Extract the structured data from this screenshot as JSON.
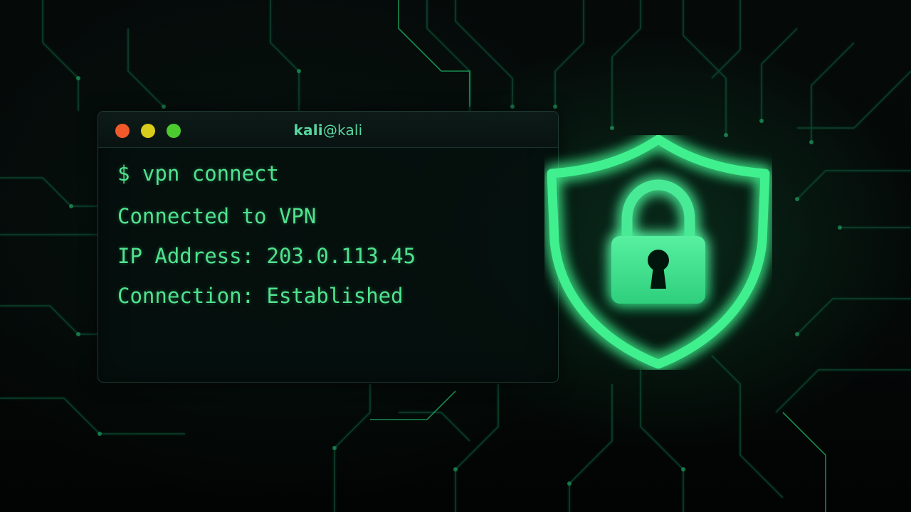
{
  "terminal": {
    "title_user": "kali",
    "title_host": "@kali",
    "window_buttons": [
      "close",
      "minimize",
      "maximize"
    ],
    "lines": [
      "$ vpn connect",
      "Connected to VPN",
      "IP Address: 203.0.113.45",
      "Connection: Established"
    ]
  },
  "icons": {
    "shield": "shield-icon",
    "lock": "padlock-icon"
  },
  "colors": {
    "accent": "#4fe38e",
    "close": "#f05a2a",
    "minimize": "#d8cc1c",
    "maximize": "#4ccb2e",
    "background": "#030706"
  }
}
